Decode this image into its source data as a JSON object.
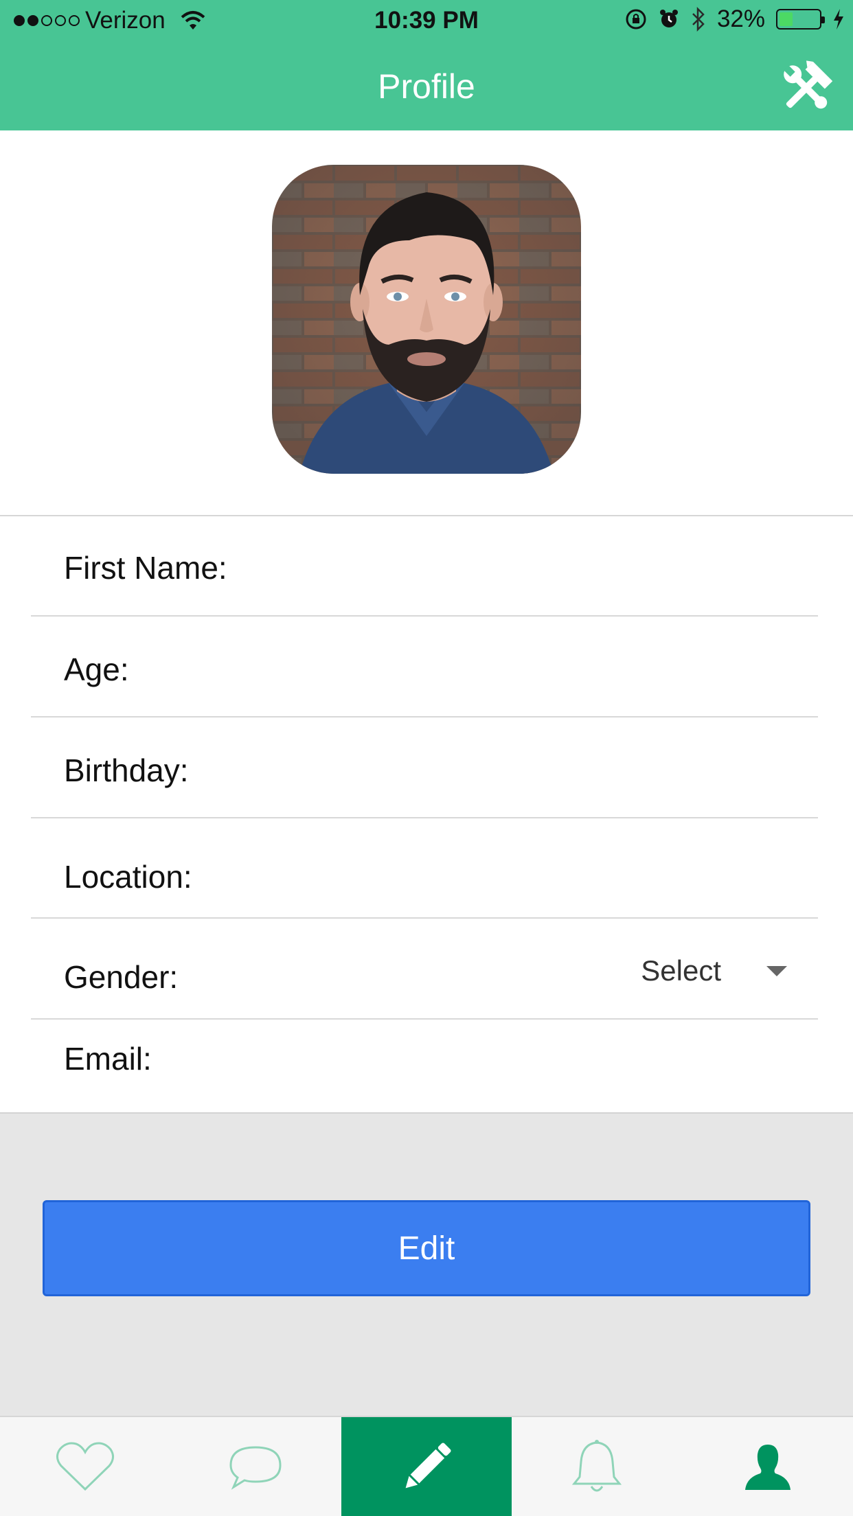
{
  "status_bar": {
    "carrier": "Verizon",
    "time": "10:39 PM",
    "battery": "32%",
    "battery_level": 0.32,
    "icons": [
      "signal-dots",
      "wifi-icon",
      "orientation-lock-icon",
      "alarm-icon",
      "bluetooth-icon",
      "battery-icon",
      "charging-bolt-icon"
    ]
  },
  "nav": {
    "title": "Profile",
    "right_icon": "tools-icon"
  },
  "avatar": {
    "icon": "profile-photo"
  },
  "form": {
    "fields": [
      {
        "label": "First Name:",
        "value": ""
      },
      {
        "label": "Age:",
        "value": ""
      },
      {
        "label": "Birthday:",
        "value": ""
      },
      {
        "label": "Location:",
        "value": ""
      },
      {
        "label": "Gender:",
        "value": "Select"
      },
      {
        "label": "Email:",
        "value": ""
      }
    ]
  },
  "actions": {
    "edit_label": "Edit"
  },
  "tabbar": {
    "tabs": [
      {
        "icon": "heart-icon",
        "active": false
      },
      {
        "icon": "chat-bubble-icon",
        "active": false
      },
      {
        "icon": "pencil-icon",
        "active": true
      },
      {
        "icon": "bell-icon",
        "active": false
      },
      {
        "icon": "user-icon",
        "active": false
      }
    ]
  },
  "colors": {
    "nav_bar": "#48c594",
    "edit_button": "#3b7ef0",
    "active_tab": "#00935f",
    "icon_tint": "#8fd4b8"
  }
}
